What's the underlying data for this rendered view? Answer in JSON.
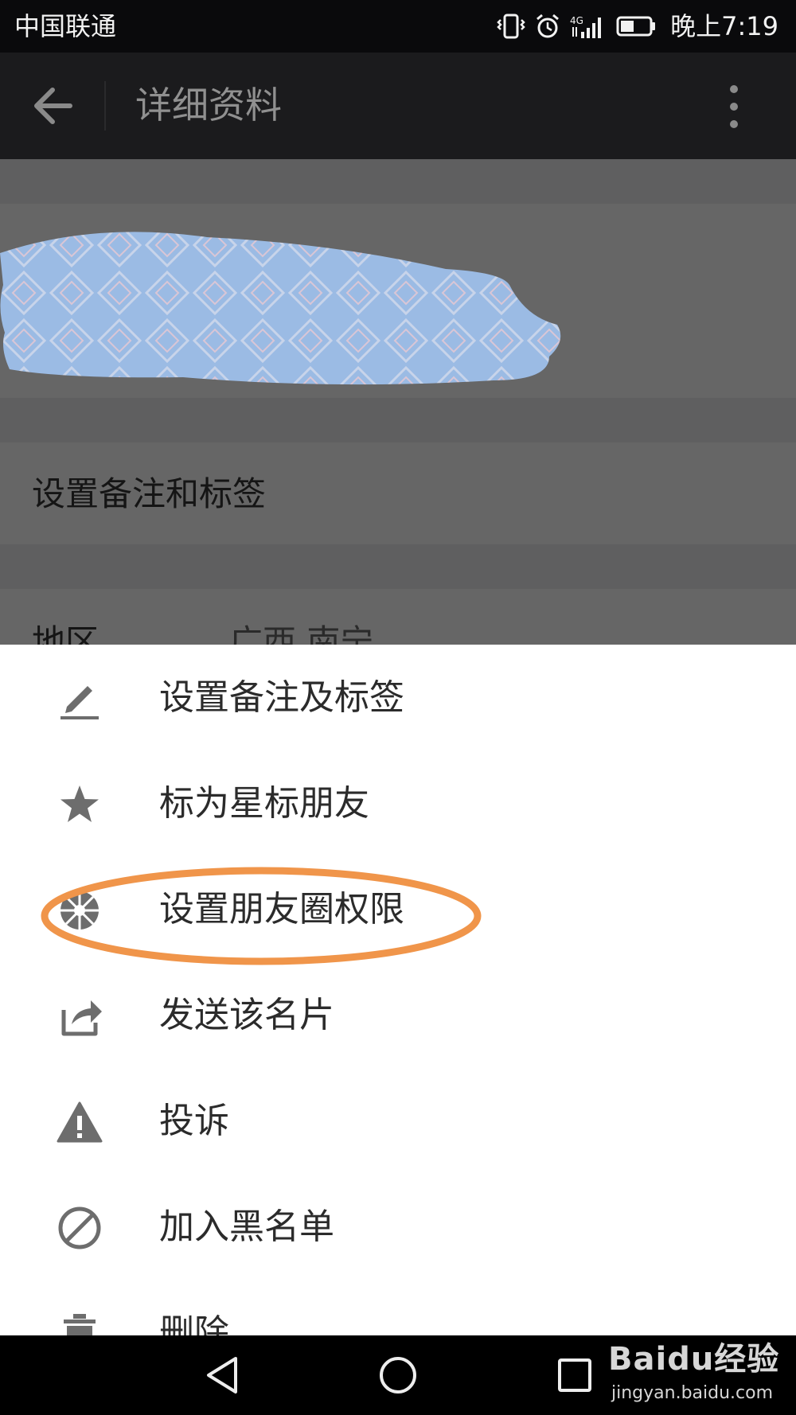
{
  "status_bar": {
    "carrier": "中国联通",
    "time": "晚上7:19",
    "icons": [
      "vibrate-icon",
      "alarm-icon",
      "signal-icon",
      "battery-icon"
    ]
  },
  "app_bar": {
    "title": "详细资料",
    "back_icon": "arrow-left-icon",
    "more_icon": "more-vertical-icon"
  },
  "profile": {
    "remark_row": "设置备注和标签",
    "region_label": "地区",
    "region_value": "广西  南宁"
  },
  "menu": {
    "items": [
      {
        "label": "设置备注及标签",
        "icon": "pencil-icon"
      },
      {
        "label": "标为星标朋友",
        "icon": "star-icon"
      },
      {
        "label": "设置朋友圈权限",
        "icon": "moments-aperture-icon",
        "highlighted": true
      },
      {
        "label": "发送该名片",
        "icon": "share-icon"
      },
      {
        "label": "投诉",
        "icon": "warning-icon"
      },
      {
        "label": "加入黑名单",
        "icon": "block-icon"
      },
      {
        "label": "删除",
        "icon": "trash-icon"
      }
    ]
  },
  "nav_bar": {
    "buttons": [
      "back-triangle-icon",
      "home-circle-icon",
      "recents-square-icon"
    ]
  },
  "watermark": {
    "brand": "Baidu经验",
    "url": "jingyan.baidu.com"
  },
  "colors": {
    "status_bar_bg": "#0a0a0c",
    "app_bar_bg": "#1b1b1d",
    "dim_overlay": "#5f5f60",
    "sheet_bg": "#ffffff",
    "menu_text": "#2b2b2b",
    "menu_icon": "#6d6d6d",
    "highlight_ellipse": "#f0954a",
    "redaction": "#9bbbe4"
  }
}
